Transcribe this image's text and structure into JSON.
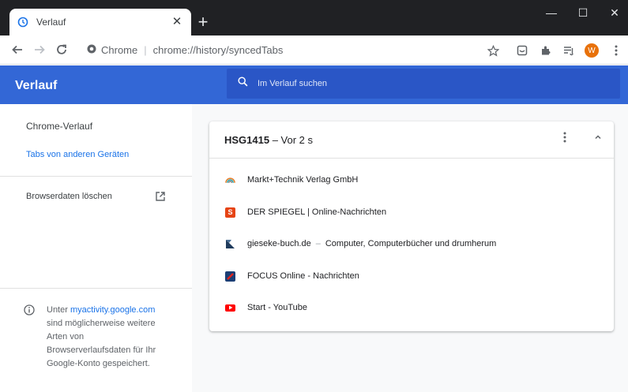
{
  "tab": {
    "title": "Verlauf",
    "close": "✕"
  },
  "newtab": "+",
  "window_controls": {
    "minimize": "—",
    "maximize": "☐",
    "close": "✕"
  },
  "omnibox": {
    "site_label": "Chrome",
    "url": "chrome://history/syncedTabs"
  },
  "profile": {
    "initial": "W"
  },
  "header": {
    "title": "Verlauf",
    "search_placeholder": "Im Verlauf suchen"
  },
  "sidebar": {
    "chrome_history": "Chrome-Verlauf",
    "other_devices": "Tabs von anderen Geräten",
    "clear_data": "Browserdaten löschen"
  },
  "footer": {
    "prefix": "Unter ",
    "link": "myactivity.google.com",
    "line2": "sind möglicherweise weitere",
    "line3": "Arten von",
    "line4": "Browserverlaufsdaten für Ihr",
    "line5": "Google-Konto gespeichert."
  },
  "card": {
    "device": "HSG1415",
    "time": " – Vor 2 s",
    "entries": [
      {
        "title": "Markt+Technik Verlag GmbH",
        "icon": "markt-technik-favicon"
      },
      {
        "title": "DER SPIEGEL | Online-Nachrichten",
        "icon": "spiegel-favicon"
      },
      {
        "domain": "gieseke-buch.de",
        "sep": "–",
        "title": "Computer, Computerbücher und drumherum",
        "icon": "gieseke-favicon"
      },
      {
        "title": "FOCUS Online - Nachrichten",
        "icon": "focus-favicon"
      },
      {
        "title": "Start - YouTube",
        "icon": "youtube-favicon"
      }
    ]
  },
  "colors": {
    "header_bg": "#3367d6",
    "search_bg": "#2a56c6",
    "link": "#1a73e8",
    "titlebar": "#202124",
    "avatar": "#e8710a"
  }
}
